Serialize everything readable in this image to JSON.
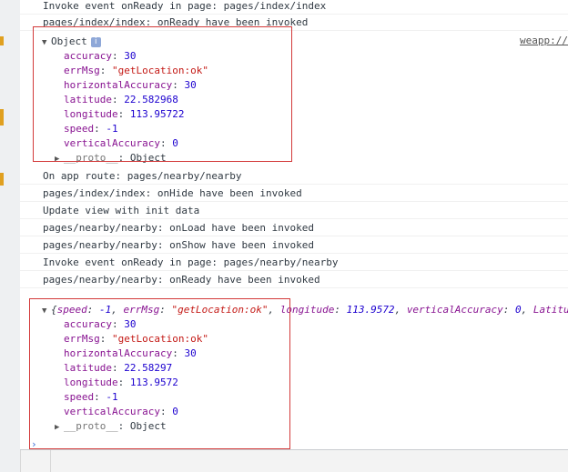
{
  "console": {
    "top_lines": [
      "Invoke event onReady in page: pages/index/index",
      "pages/index/index: onReady have been invoked"
    ],
    "object1": {
      "header": "Object",
      "info_glyph": "i",
      "source_link": "weapp://",
      "props": [
        {
          "key": "accuracy",
          "value": "30",
          "type": "num"
        },
        {
          "key": "errMsg",
          "value": "\"getLocation:ok\"",
          "type": "str"
        },
        {
          "key": "horizontalAccuracy",
          "value": "30",
          "type": "num"
        },
        {
          "key": "latitude",
          "value": "22.582968",
          "type": "num"
        },
        {
          "key": "longitude",
          "value": "113.95722",
          "type": "num"
        },
        {
          "key": "speed",
          "value": "-1",
          "type": "num"
        },
        {
          "key": "verticalAccuracy",
          "value": "0",
          "type": "num"
        }
      ],
      "proto_key": "__proto__",
      "proto_value": "Object"
    },
    "middle_lines": [
      "On app route: pages/nearby/nearby",
      "pages/index/index: onHide have been invoked",
      "Update view with init data",
      "pages/nearby/nearby: onLoad have been invoked",
      "pages/nearby/nearby: onShow have been invoked",
      "Invoke event onReady in page: pages/nearby/nearby",
      "pages/nearby/nearby: onReady have been invoked"
    ],
    "object2": {
      "summary": {
        "open": "{",
        "speed_key": "speed",
        "speed_val": "-1",
        "errmsg_key": "errMsg",
        "errmsg_val": "\"getLocation:ok\"",
        "longitude_key": "longitude",
        "longitude_val": "113.9572",
        "vacc_key": "verticalAccuracy",
        "vacc_val": "0",
        "trailing_key": "Latitu"
      },
      "props": [
        {
          "key": "accuracy",
          "value": "30",
          "type": "num"
        },
        {
          "key": "errMsg",
          "value": "\"getLocation:ok\"",
          "type": "str"
        },
        {
          "key": "horizontalAccuracy",
          "value": "30",
          "type": "num"
        },
        {
          "key": "latitude",
          "value": "22.58297",
          "type": "num"
        },
        {
          "key": "longitude",
          "value": "113.9572",
          "type": "num"
        },
        {
          "key": "speed",
          "value": "-1",
          "type": "num"
        },
        {
          "key": "verticalAccuracy",
          "value": "0",
          "type": "num"
        }
      ],
      "proto_key": "__proto__",
      "proto_value": "Object"
    },
    "prompt_glyph": "›"
  },
  "colors": {
    "key": "#881391",
    "number": "#1c00cf",
    "string": "#c41a16",
    "annotation_box": "#d33a3a"
  }
}
